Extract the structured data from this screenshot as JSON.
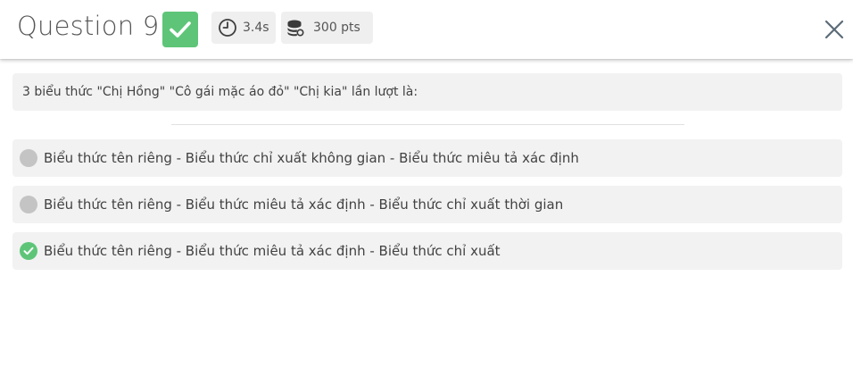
{
  "header": {
    "question_title": "Question 9",
    "result_status": "correct",
    "time_taken": "3.4s",
    "points": "300 pts",
    "icons": {
      "result": "checkmark-icon",
      "time": "clock-icon",
      "points": "coins-icon",
      "close": "close-icon"
    }
  },
  "question": {
    "prompt": "3 biểu thức \"Chị Hồng\" \"Cô gái mặc áo đỏ\" \"Chị kia\" lần lượt là:"
  },
  "options": [
    {
      "label": "Biểu thức tên riêng - Biểu thức chỉ xuất không gian - Biểu thức miêu tả xác định",
      "state": "unselected"
    },
    {
      "label": "Biểu thức tên riêng - Biểu thức miêu tả xác định - Biểu thức chỉ xuất thời gian",
      "state": "unselected"
    },
    {
      "label": "Biểu thức tên riêng - Biểu thức miêu tả xác định - Biểu thức chỉ xuất",
      "state": "correct"
    }
  ],
  "colors": {
    "correct_green": "#5ec578",
    "neutral_gray": "#c4c4c4",
    "panel_bg": "#f2f2f2",
    "chip_bg": "#efefef",
    "text": "#424242"
  }
}
